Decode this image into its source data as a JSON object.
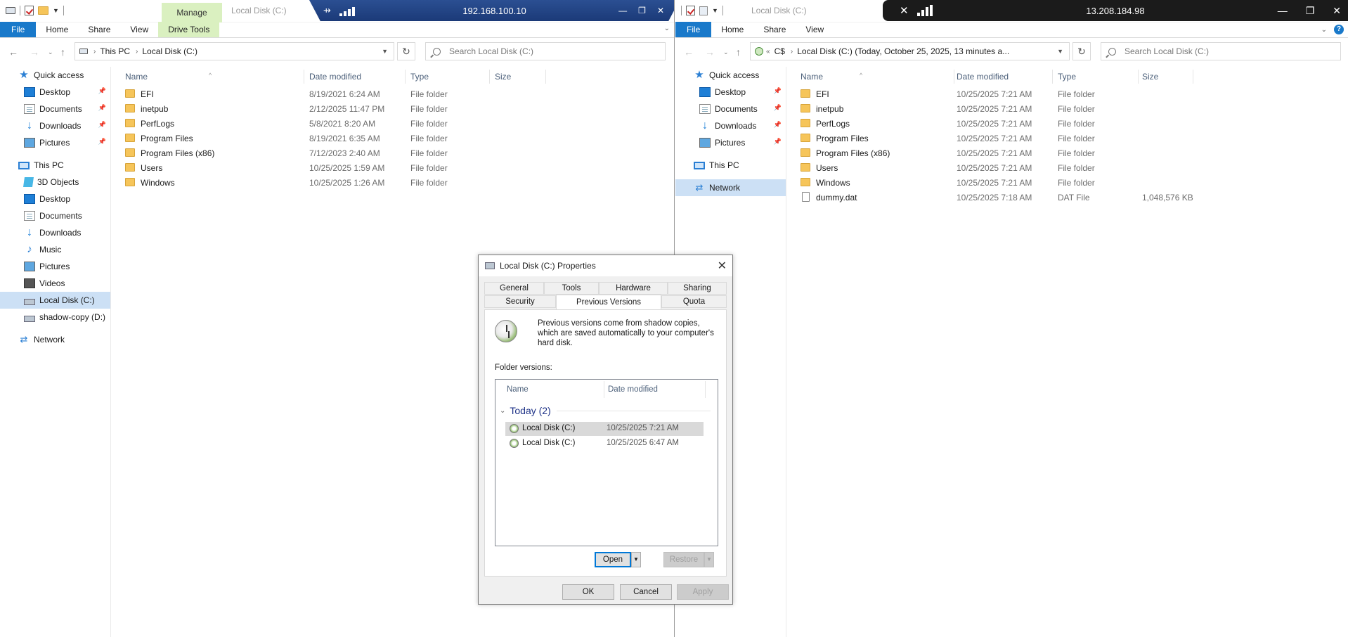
{
  "left": {
    "manage_tab": "Manage",
    "title": "Local Disk (C:)",
    "ribbon_tabs": [
      "File",
      "Home",
      "Share",
      "View",
      "Drive Tools"
    ],
    "breadcrumb": [
      "This PC",
      "Local Disk (C:)"
    ],
    "search_placeholder": "Search Local Disk (C:)",
    "columns": [
      "Name",
      "Date modified",
      "Type",
      "Size"
    ],
    "nav": [
      {
        "label": "Quick access",
        "icon": "star-icon"
      },
      {
        "label": "Desktop",
        "icon": "desktop-icon"
      },
      {
        "label": "Documents",
        "icon": "documents-icon"
      },
      {
        "label": "Downloads",
        "icon": "downloads-icon"
      },
      {
        "label": "Pictures",
        "icon": "pictures-icon"
      },
      {
        "label": "This PC",
        "icon": "pc-icon"
      },
      {
        "label": "3D Objects",
        "icon": "cube-icon"
      },
      {
        "label": "Desktop",
        "icon": "desktop-icon"
      },
      {
        "label": "Documents",
        "icon": "documents-icon"
      },
      {
        "label": "Downloads",
        "icon": "downloads-icon"
      },
      {
        "label": "Music",
        "icon": "music-icon"
      },
      {
        "label": "Pictures",
        "icon": "pictures-icon"
      },
      {
        "label": "Videos",
        "icon": "videos-icon"
      },
      {
        "label": "Local Disk (C:)",
        "icon": "drive-icon"
      },
      {
        "label": "shadow-copy (D:)",
        "icon": "drive-icon"
      },
      {
        "label": "Network",
        "icon": "network-icon"
      }
    ],
    "files": [
      {
        "name": "EFI",
        "date": "8/19/2021 6:24 AM",
        "type": "File folder",
        "size": ""
      },
      {
        "name": "inetpub",
        "date": "2/12/2025 11:47 PM",
        "type": "File folder",
        "size": ""
      },
      {
        "name": "PerfLogs",
        "date": "5/8/2021 8:20 AM",
        "type": "File folder",
        "size": ""
      },
      {
        "name": "Program Files",
        "date": "8/19/2021 6:35 AM",
        "type": "File folder",
        "size": ""
      },
      {
        "name": "Program Files (x86)",
        "date": "7/12/2023 2:40 AM",
        "type": "File folder",
        "size": ""
      },
      {
        "name": "Users",
        "date": "10/25/2025 1:59 AM",
        "type": "File folder",
        "size": ""
      },
      {
        "name": "Windows",
        "date": "10/25/2025 1:26 AM",
        "type": "File folder",
        "size": ""
      }
    ],
    "remote_ip": "192.168.100.10"
  },
  "right": {
    "title": "Local Disk (C:)",
    "ribbon_tabs": [
      "File",
      "Home",
      "Share",
      "View"
    ],
    "breadcrumb": [
      "C$",
      "Local Disk (C:) (Today, October 25, 2025, 13 minutes a..."
    ],
    "search_placeholder": "Search Local Disk (C:)",
    "columns": [
      "Name",
      "Date modified",
      "Type",
      "Size"
    ],
    "nav": [
      {
        "label": "Quick access",
        "icon": "star-icon"
      },
      {
        "label": "Desktop",
        "icon": "desktop-icon"
      },
      {
        "label": "Documents",
        "icon": "documents-icon"
      },
      {
        "label": "Downloads",
        "icon": "downloads-icon"
      },
      {
        "label": "Pictures",
        "icon": "pictures-icon"
      },
      {
        "label": "This PC",
        "icon": "pc-icon"
      },
      {
        "label": "Network",
        "icon": "network-icon"
      }
    ],
    "files": [
      {
        "name": "EFI",
        "date": "10/25/2025 7:21 AM",
        "type": "File folder",
        "size": ""
      },
      {
        "name": "inetpub",
        "date": "10/25/2025 7:21 AM",
        "type": "File folder",
        "size": ""
      },
      {
        "name": "PerfLogs",
        "date": "10/25/2025 7:21 AM",
        "type": "File folder",
        "size": ""
      },
      {
        "name": "Program Files",
        "date": "10/25/2025 7:21 AM",
        "type": "File folder",
        "size": ""
      },
      {
        "name": "Program Files (x86)",
        "date": "10/25/2025 7:21 AM",
        "type": "File folder",
        "size": ""
      },
      {
        "name": "Users",
        "date": "10/25/2025 7:21 AM",
        "type": "File folder",
        "size": ""
      },
      {
        "name": "Windows",
        "date": "10/25/2025 7:21 AM",
        "type": "File folder",
        "size": ""
      },
      {
        "name": "dummy.dat",
        "date": "10/25/2025 7:18 AM",
        "type": "DAT File",
        "size": "1,048,576 KB"
      }
    ],
    "remote_ip": "13.208.184.98"
  },
  "dialog": {
    "title": "Local Disk (C:) Properties",
    "tabs_top": [
      "General",
      "Tools",
      "Hardware",
      "Sharing"
    ],
    "tabs_bottom": [
      "Security",
      "Previous Versions",
      "Quota"
    ],
    "info": "Previous versions come from shadow copies, which are saved automatically to your computer's hard disk.",
    "folder_versions_label": "Folder versions:",
    "columns": [
      "Name",
      "Date modified"
    ],
    "group": "Today (2)",
    "versions": [
      {
        "name": "Local Disk (C:)",
        "date": "10/25/2025 7:21 AM"
      },
      {
        "name": "Local Disk (C:)",
        "date": "10/25/2025 6:47 AM"
      }
    ],
    "open": "Open",
    "restore": "Restore",
    "ok": "OK",
    "cancel": "Cancel",
    "apply": "Apply"
  },
  "colors": {
    "accent": "#1979ca",
    "selection": "#cce0f5",
    "manage": "#daf0c0"
  }
}
